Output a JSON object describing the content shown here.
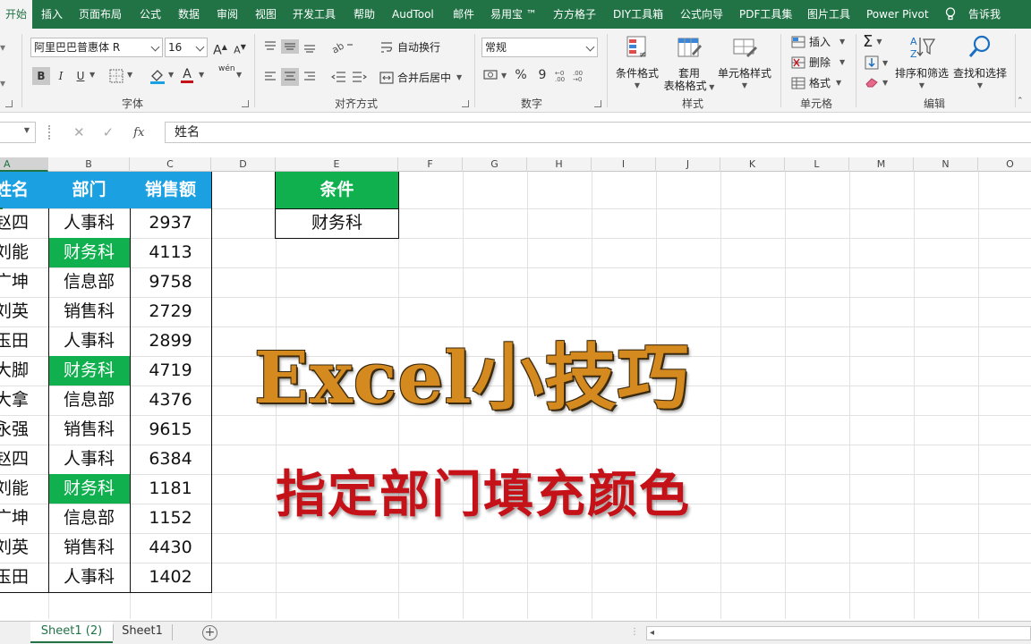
{
  "ribbon_tabs": [
    "开始",
    "插入",
    "页面布局",
    "公式",
    "数据",
    "审阅",
    "视图",
    "开发工具",
    "帮助",
    "AudTool",
    "邮件",
    "易用宝 ™",
    "方方格子",
    "DIY工具箱",
    "公式向导",
    "PDF工具集",
    "图片工具",
    "Power Pivot",
    "告诉我"
  ],
  "font_group": {
    "font_name": "阿里巴巴普惠体 R",
    "font_size": "16",
    "grow": "A",
    "shrink": "A",
    "bold": "B",
    "italic": "I",
    "underline": "U",
    "font_color": "A",
    "phonetic": "wén",
    "label": "字体"
  },
  "align_group": {
    "wrap_text": "自动换行",
    "merge_center": "合并后居中",
    "label": "对齐方式"
  },
  "number_group": {
    "format": "常规",
    "percent": "%",
    "comma": "9",
    "label": "数字"
  },
  "styles_group": {
    "cond_format": "条件格式",
    "table_format_1": "套用",
    "table_format_2": "表格格式",
    "cell_styles": "单元格样式",
    "label": "样式"
  },
  "cells_group": {
    "insert": "插入",
    "delete": "删除",
    "format": "格式",
    "label": "单元格"
  },
  "editing_group": {
    "sum": "Σ",
    "sort_filter": "排序和筛选",
    "find_select": "查找和选择",
    "label": "编辑"
  },
  "formula_bar": {
    "content": "姓名",
    "fx": "fx"
  },
  "columns": [
    "A",
    "B",
    "C",
    "D",
    "E",
    "F",
    "G",
    "H",
    "I",
    "J",
    "K",
    "L",
    "M",
    "N",
    "O"
  ],
  "table": {
    "headers": [
      "姓名",
      "部门",
      "销售额"
    ],
    "rows": [
      {
        "name": "赵四",
        "dept": "人事科",
        "sales": "2937"
      },
      {
        "name": "刘能",
        "dept": "财务科",
        "sales": "4113"
      },
      {
        "name": "广坤",
        "dept": "信息部",
        "sales": "9758"
      },
      {
        "name": "刘英",
        "dept": "销售科",
        "sales": "2729"
      },
      {
        "name": "玉田",
        "dept": "人事科",
        "sales": "2899"
      },
      {
        "name": "大脚",
        "dept": "财务科",
        "sales": "4719"
      },
      {
        "name": "大拿",
        "dept": "信息部",
        "sales": "4376"
      },
      {
        "name": "永强",
        "dept": "销售科",
        "sales": "9615"
      },
      {
        "name": "赵四",
        "dept": "人事科",
        "sales": "6384"
      },
      {
        "name": "刘能",
        "dept": "财务科",
        "sales": "1181"
      },
      {
        "name": "广坤",
        "dept": "信息部",
        "sales": "1152"
      },
      {
        "name": "刘英",
        "dept": "销售科",
        "sales": "4430"
      },
      {
        "name": "玉田",
        "dept": "人事科",
        "sales": "1402"
      }
    ]
  },
  "condition": {
    "header": "条件",
    "value": "财务科"
  },
  "overlay": {
    "title": "Excel小技巧",
    "subtitle": "指定部门填充颜色"
  },
  "sheets": [
    "Sheet1 (2)",
    "Sheet1"
  ],
  "colors": {
    "excel_green": "#217346",
    "header_blue": "#1ba1e2",
    "highlight_green": "#11b04f",
    "title_orange": "#d58a1f",
    "subtitle_red": "#c41218"
  }
}
